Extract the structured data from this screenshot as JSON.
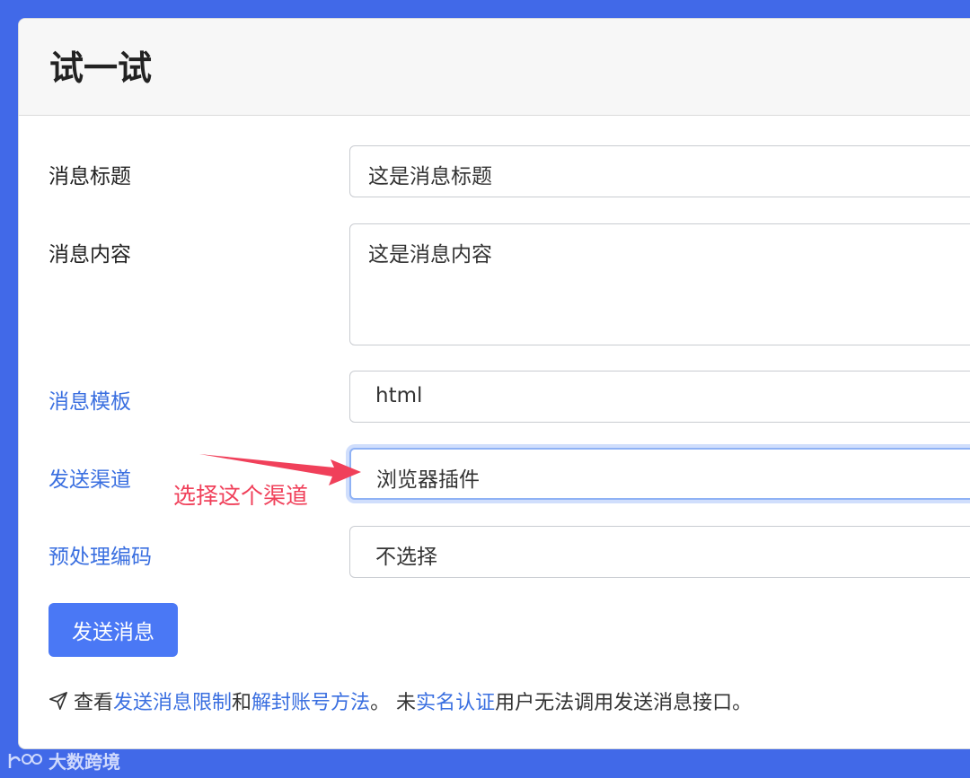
{
  "header": {
    "title": "试一试"
  },
  "form": {
    "title_label": "消息标题",
    "title_value": "这是消息标题",
    "content_label": "消息内容",
    "content_value": "这是消息内容",
    "template_label": "消息模板",
    "template_value": "html",
    "channel_label": "发送渠道",
    "channel_value": "浏览器插件",
    "preprocess_label": "预处理编码",
    "preprocess_value": "不选择",
    "submit_label": "发送消息"
  },
  "annotation": {
    "text": "选择这个渠道",
    "color": "#f0405a"
  },
  "note": {
    "icon": "paper-plane-icon",
    "part1": "查看",
    "link1": "发送消息限制",
    "part2": "和",
    "link2": "解封账号方法",
    "part3": "。 未",
    "link3": "实名认证",
    "part4": "用户无法调用发送消息接口。"
  },
  "watermark": {
    "text": "大数跨境",
    "icon": "logo-icon"
  },
  "colors": {
    "background": "#4169e8",
    "accent": "#4a78f5",
    "link": "#3a6fe0",
    "annotation": "#f0405a"
  }
}
